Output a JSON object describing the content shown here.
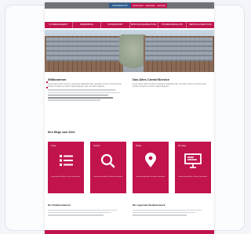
{
  "browser": {
    "brand_left": "UNIVERSITÄT",
    "brand_right": "Sicherheit · Gebäude · Technik"
  },
  "nav": {
    "items": [
      "STUDIENANGEBOT",
      "BEWERBUNG",
      "STUDIENSTART",
      "PRÜFUNGSVERWALTUNG",
      "STUDIENABSCHLUSS",
      "SERVICE & BERATUNG"
    ]
  },
  "welcome": {
    "title": "Willkommen",
    "text": "Lorem ipsum dolor sit amet, consetetur sadipscing elitr, sed diam nonumy eirmod tempor invidunt ut labore et dolore magna aliquyam erat, sed diam voluptua."
  },
  "service": {
    "title": "Das Alles Center/Service",
    "text": "Lorem ipsum dolor sit amet, consetetur sadipscing elitr, sed diam nonumy eirmod tempor invidunt ut labore et dolore magna aliquyam."
  },
  "section": {
    "title": "Ihre Wege zum Ziele"
  },
  "tiles": [
    {
      "title": "Liste",
      "icon": "list-icon",
      "glyph": "☰",
      "text": "Lorem ipsum dolor sit amet consetetur"
    },
    {
      "title": "Suche",
      "icon": "search-icon",
      "glyph": "⌕",
      "text": "Lorem ipsum dolor sit amet consetetur"
    },
    {
      "title": "Karte",
      "icon": "location-pin-icon",
      "glyph": "⬤",
      "text": "Lorem ipsum dolor sit amet consetetur"
    },
    {
      "title": "Ihr Idee",
      "icon": "presentation-board-icon",
      "glyph": "▭",
      "text": "Lorem ipsum dolor sit amet consetetur"
    }
  ],
  "bottom": {
    "left_title": "Der Studierendenrat",
    "right_title": "Der regionale Studentenwerk"
  },
  "colors": {
    "accent": "#c1144d",
    "brand_blue": "#2f5c8f"
  }
}
